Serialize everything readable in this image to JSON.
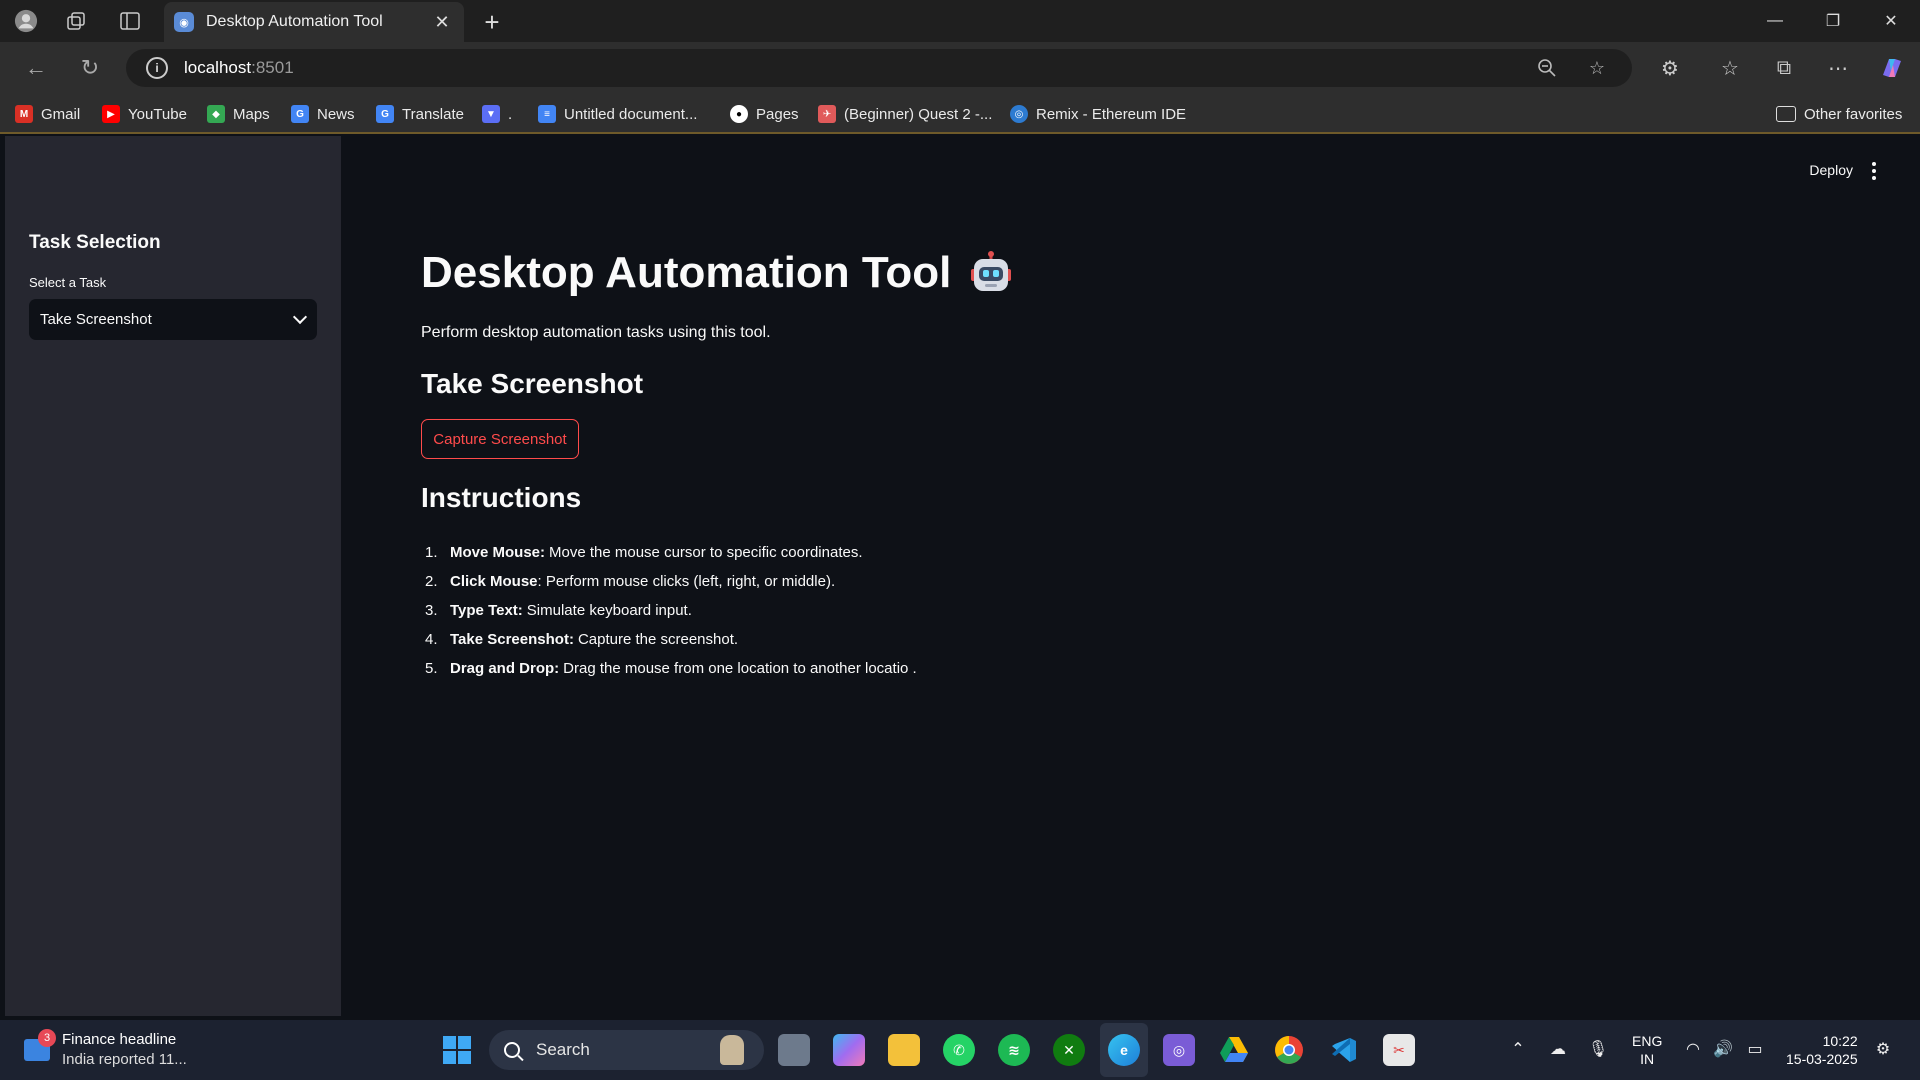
{
  "browser": {
    "tab_title": "Desktop Automation Tool",
    "url_host": "localhost",
    "url_port": ":8501",
    "bookmarks": [
      {
        "label": "Gmail",
        "icon": "gmail-icon",
        "color": "#d93025"
      },
      {
        "label": "YouTube",
        "icon": "youtube-icon",
        "color": "#ff0000"
      },
      {
        "label": "Maps",
        "icon": "maps-icon",
        "color": "#34a853"
      },
      {
        "label": "News",
        "icon": "news-icon",
        "color": "#4285f4"
      },
      {
        "label": "Translate",
        "icon": "translate-icon",
        "color": "#4285f4"
      },
      {
        "label": ".",
        "icon": "vee-icon",
        "color": "#5b6ef5"
      },
      {
        "label": "Untitled document...",
        "icon": "docs-icon",
        "color": "#4285f4"
      },
      {
        "label": "Pages",
        "icon": "github-icon",
        "color": "#ffffff"
      },
      {
        "label": "(Beginner) Quest 2 -...",
        "icon": "quest-icon",
        "color": "#e05a5a"
      },
      {
        "label": "Remix - Ethereum IDE",
        "icon": "remix-icon",
        "color": "#2d7bd1"
      }
    ],
    "other_favorites": "Other favorites"
  },
  "app": {
    "deploy_label": "Deploy",
    "sidebar": {
      "title": "Task Selection",
      "select_label": "Select a Task",
      "selected_task": "Take Screenshot"
    },
    "main": {
      "title": "Desktop Automation Tool",
      "intro": "Perform desktop automation tasks using this tool.",
      "section_title": "Take Screenshot",
      "capture_button": "Capture Screenshot",
      "instructions_title": "Instructions",
      "instructions": [
        {
          "num": "1.",
          "term": "Move Mouse:",
          "desc": "Move the mouse cursor to specific coordinates."
        },
        {
          "num": "2.",
          "term": "Click Mouse",
          "desc": ": Perform mouse clicks (left, right, or middle)."
        },
        {
          "num": "3.",
          "term": "Type Text:",
          "desc": "Simulate keyboard input."
        },
        {
          "num": "4.",
          "term": "Take Screenshot:",
          "desc": "Capture the screenshot."
        },
        {
          "num": "5.",
          "term": "Drag and Drop:",
          "desc": "Drag the mouse from one location to another locatio ."
        }
      ],
      "accent_color": "#ff4b4b"
    }
  },
  "taskbar": {
    "news_badge": "3",
    "news_title": "Finance headline",
    "news_subtitle": "India reported 11...",
    "search_label": "Search",
    "lang_line1": "ENG",
    "lang_line2": "IN",
    "time": "10:22",
    "date": "15-03-2025"
  }
}
